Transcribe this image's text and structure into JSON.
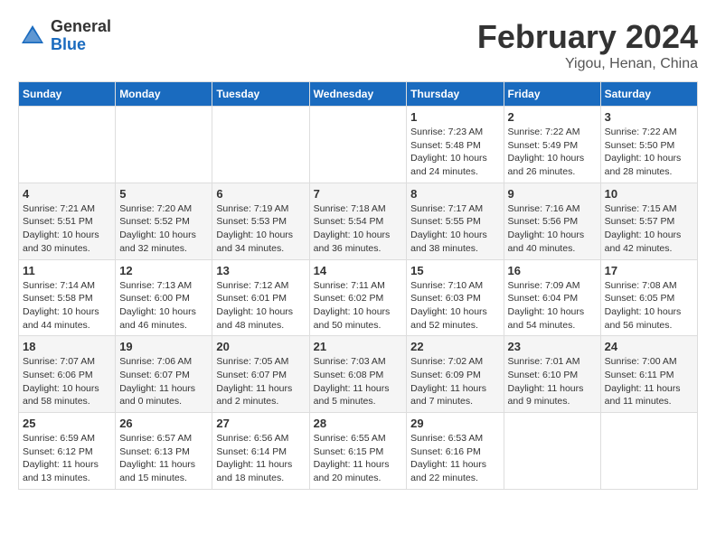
{
  "header": {
    "logo_general": "General",
    "logo_blue": "Blue",
    "month_year": "February 2024",
    "location": "Yigou, Henan, China"
  },
  "weekdays": [
    "Sunday",
    "Monday",
    "Tuesday",
    "Wednesday",
    "Thursday",
    "Friday",
    "Saturday"
  ],
  "weeks": [
    [
      {
        "day": "",
        "info": ""
      },
      {
        "day": "",
        "info": ""
      },
      {
        "day": "",
        "info": ""
      },
      {
        "day": "",
        "info": ""
      },
      {
        "day": "1",
        "info": "Sunrise: 7:23 AM\nSunset: 5:48 PM\nDaylight: 10 hours and 24 minutes."
      },
      {
        "day": "2",
        "info": "Sunrise: 7:22 AM\nSunset: 5:49 PM\nDaylight: 10 hours and 26 minutes."
      },
      {
        "day": "3",
        "info": "Sunrise: 7:22 AM\nSunset: 5:50 PM\nDaylight: 10 hours and 28 minutes."
      }
    ],
    [
      {
        "day": "4",
        "info": "Sunrise: 7:21 AM\nSunset: 5:51 PM\nDaylight: 10 hours and 30 minutes."
      },
      {
        "day": "5",
        "info": "Sunrise: 7:20 AM\nSunset: 5:52 PM\nDaylight: 10 hours and 32 minutes."
      },
      {
        "day": "6",
        "info": "Sunrise: 7:19 AM\nSunset: 5:53 PM\nDaylight: 10 hours and 34 minutes."
      },
      {
        "day": "7",
        "info": "Sunrise: 7:18 AM\nSunset: 5:54 PM\nDaylight: 10 hours and 36 minutes."
      },
      {
        "day": "8",
        "info": "Sunrise: 7:17 AM\nSunset: 5:55 PM\nDaylight: 10 hours and 38 minutes."
      },
      {
        "day": "9",
        "info": "Sunrise: 7:16 AM\nSunset: 5:56 PM\nDaylight: 10 hours and 40 minutes."
      },
      {
        "day": "10",
        "info": "Sunrise: 7:15 AM\nSunset: 5:57 PM\nDaylight: 10 hours and 42 minutes."
      }
    ],
    [
      {
        "day": "11",
        "info": "Sunrise: 7:14 AM\nSunset: 5:58 PM\nDaylight: 10 hours and 44 minutes."
      },
      {
        "day": "12",
        "info": "Sunrise: 7:13 AM\nSunset: 6:00 PM\nDaylight: 10 hours and 46 minutes."
      },
      {
        "day": "13",
        "info": "Sunrise: 7:12 AM\nSunset: 6:01 PM\nDaylight: 10 hours and 48 minutes."
      },
      {
        "day": "14",
        "info": "Sunrise: 7:11 AM\nSunset: 6:02 PM\nDaylight: 10 hours and 50 minutes."
      },
      {
        "day": "15",
        "info": "Sunrise: 7:10 AM\nSunset: 6:03 PM\nDaylight: 10 hours and 52 minutes."
      },
      {
        "day": "16",
        "info": "Sunrise: 7:09 AM\nSunset: 6:04 PM\nDaylight: 10 hours and 54 minutes."
      },
      {
        "day": "17",
        "info": "Sunrise: 7:08 AM\nSunset: 6:05 PM\nDaylight: 10 hours and 56 minutes."
      }
    ],
    [
      {
        "day": "18",
        "info": "Sunrise: 7:07 AM\nSunset: 6:06 PM\nDaylight: 10 hours and 58 minutes."
      },
      {
        "day": "19",
        "info": "Sunrise: 7:06 AM\nSunset: 6:07 PM\nDaylight: 11 hours and 0 minutes."
      },
      {
        "day": "20",
        "info": "Sunrise: 7:05 AM\nSunset: 6:07 PM\nDaylight: 11 hours and 2 minutes."
      },
      {
        "day": "21",
        "info": "Sunrise: 7:03 AM\nSunset: 6:08 PM\nDaylight: 11 hours and 5 minutes."
      },
      {
        "day": "22",
        "info": "Sunrise: 7:02 AM\nSunset: 6:09 PM\nDaylight: 11 hours and 7 minutes."
      },
      {
        "day": "23",
        "info": "Sunrise: 7:01 AM\nSunset: 6:10 PM\nDaylight: 11 hours and 9 minutes."
      },
      {
        "day": "24",
        "info": "Sunrise: 7:00 AM\nSunset: 6:11 PM\nDaylight: 11 hours and 11 minutes."
      }
    ],
    [
      {
        "day": "25",
        "info": "Sunrise: 6:59 AM\nSunset: 6:12 PM\nDaylight: 11 hours and 13 minutes."
      },
      {
        "day": "26",
        "info": "Sunrise: 6:57 AM\nSunset: 6:13 PM\nDaylight: 11 hours and 15 minutes."
      },
      {
        "day": "27",
        "info": "Sunrise: 6:56 AM\nSunset: 6:14 PM\nDaylight: 11 hours and 18 minutes."
      },
      {
        "day": "28",
        "info": "Sunrise: 6:55 AM\nSunset: 6:15 PM\nDaylight: 11 hours and 20 minutes."
      },
      {
        "day": "29",
        "info": "Sunrise: 6:53 AM\nSunset: 6:16 PM\nDaylight: 11 hours and 22 minutes."
      },
      {
        "day": "",
        "info": ""
      },
      {
        "day": "",
        "info": ""
      }
    ]
  ]
}
